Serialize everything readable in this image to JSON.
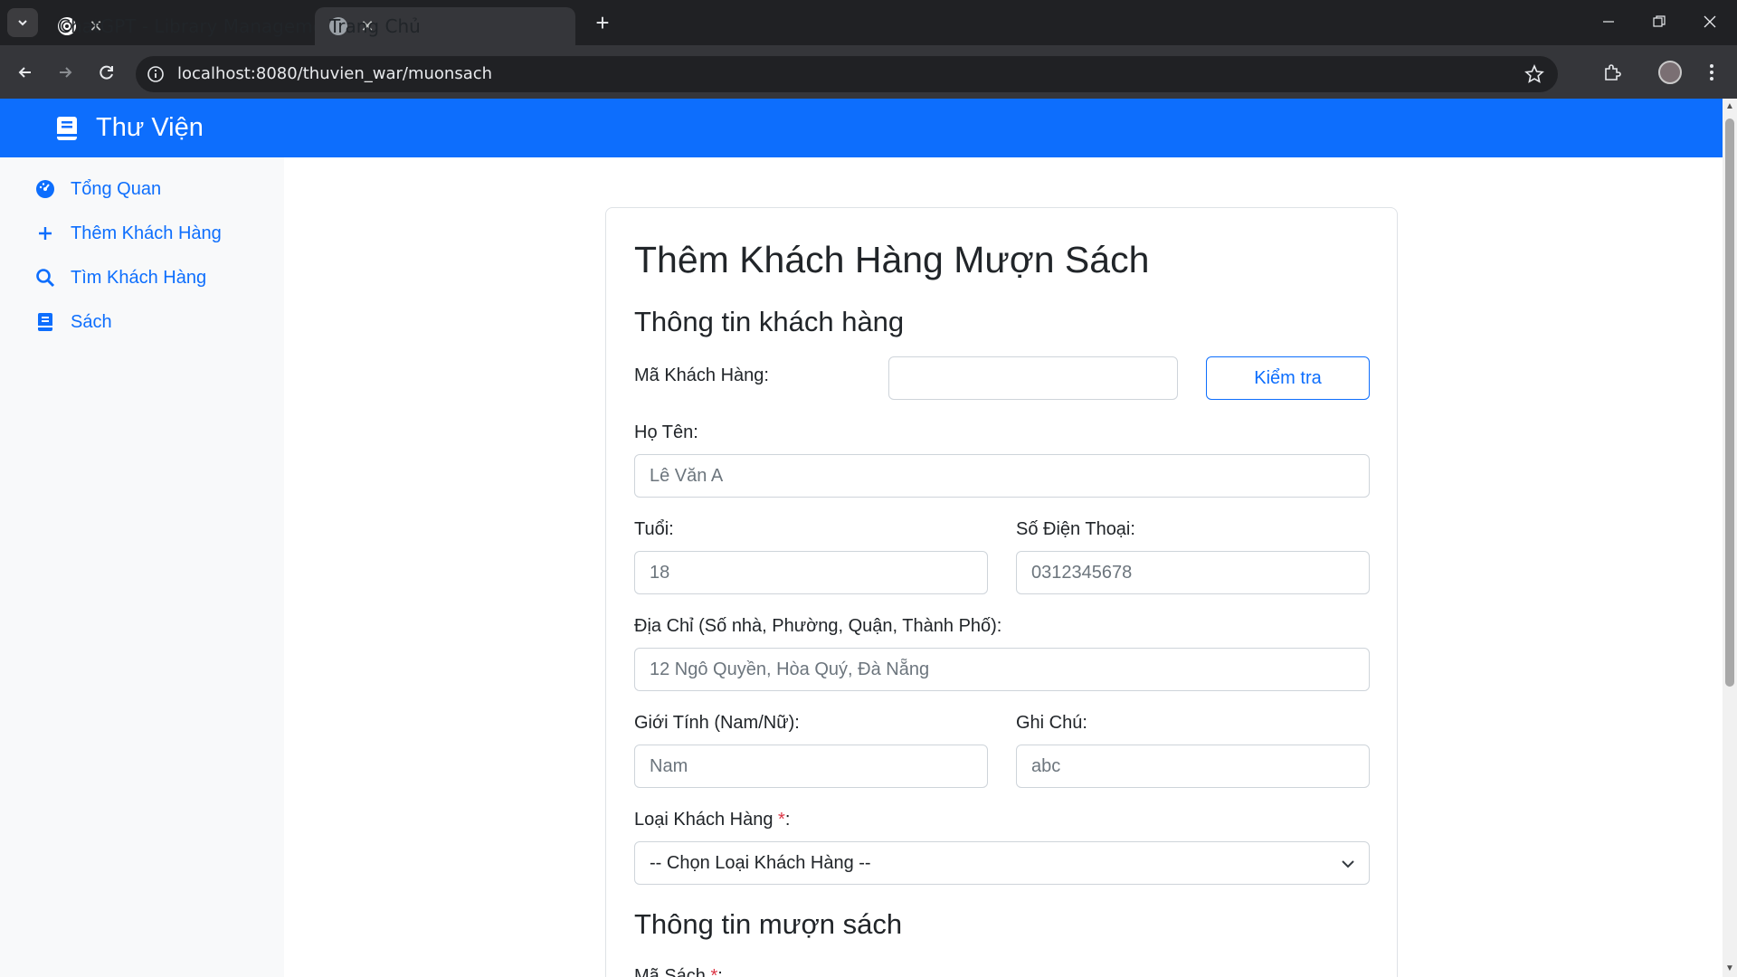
{
  "browser": {
    "tabs": [
      {
        "title": "ChatGPT - Library Management",
        "active": false
      },
      {
        "title": "Trang Chủ",
        "active": true
      }
    ],
    "url": "localhost:8080/thuvien_war/muonsach",
    "new_tab": "+"
  },
  "app": {
    "brand": "Thư Viện",
    "accent_color": "#0d6efd",
    "sidebar": [
      {
        "label": "Tổng Quan",
        "icon": "dashboard-icon"
      },
      {
        "label": "Thêm Khách Hàng",
        "icon": "plus-icon"
      },
      {
        "label": "Tìm Khách Hàng",
        "icon": "search-icon"
      },
      {
        "label": "Sách",
        "icon": "book-icon"
      }
    ]
  },
  "form": {
    "title": "Thêm Khách Hàng Mượn Sách",
    "customer_section": "Thông tin khách hàng",
    "customer_id_label": "Mã Khách Hàng:",
    "customer_id_value": "",
    "check_button": "Kiểm tra",
    "name_label": "Họ Tên:",
    "name_placeholder": "Lê Văn A",
    "age_label": "Tuổi:",
    "age_placeholder": "18",
    "phone_label": "Số Điện Thoại:",
    "phone_placeholder": "0312345678",
    "address_label": "Địa Chỉ (Số nhà, Phường, Quận, Thành Phố):",
    "address_placeholder": "12 Ngô Quyền, Hòa Quý, Đà Nẵng",
    "gender_label": "Giới Tính (Nam/Nữ):",
    "gender_placeholder": "Nam",
    "note_label": "Ghi Chú:",
    "note_placeholder": "abc",
    "type_label": "Loại Khách Hàng ",
    "required_mark": "*",
    "colon": ":",
    "type_selected": "-- Chọn Loại Khách Hàng --",
    "borrow_section": "Thông tin mượn sách",
    "book_id_label": "Mã Sách "
  }
}
